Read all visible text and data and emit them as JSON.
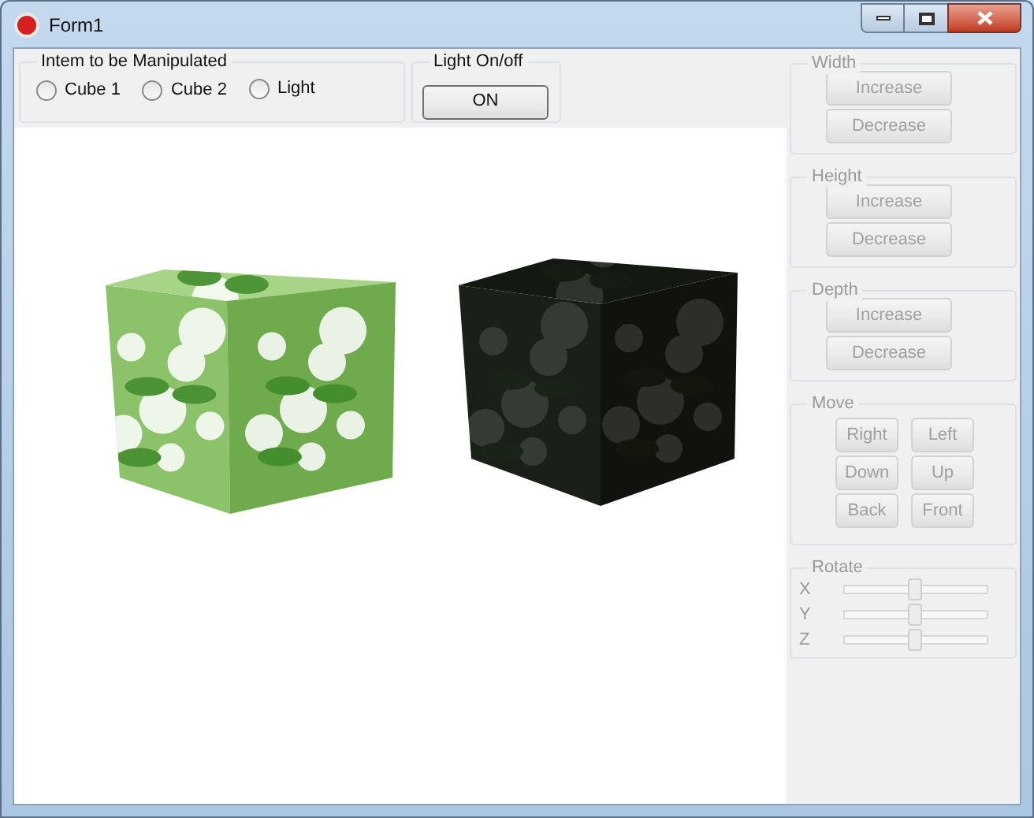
{
  "window": {
    "title": "Form1"
  },
  "item_group": {
    "label": "Intem to be Manipulated",
    "options": [
      {
        "label": "Cube 1",
        "selected": false
      },
      {
        "label": "Cube 2",
        "selected": false
      },
      {
        "label": "Light",
        "selected": false
      }
    ]
  },
  "light_group": {
    "label": "Light On/off",
    "button": "ON"
  },
  "size_groups": [
    {
      "label": "Width",
      "disabled": true,
      "buttons": [
        "Increase",
        "Decrease"
      ]
    },
    {
      "label": "Height",
      "disabled": true,
      "buttons": [
        "Increase",
        "Decrease"
      ]
    },
    {
      "label": "Depth",
      "disabled": true,
      "buttons": [
        "Increase",
        "Decrease"
      ]
    }
  ],
  "move_group": {
    "label": "Move",
    "disabled": true,
    "buttons": [
      "Right",
      "Left",
      "Down",
      "Up",
      "Back",
      "Front"
    ]
  },
  "rotate_group": {
    "label": "Rotate",
    "disabled": true,
    "sliders": [
      {
        "label": "X",
        "level": 0.5
      },
      {
        "label": "Y",
        "level": 0.5
      },
      {
        "label": "Z",
        "level": 0.5
      }
    ]
  }
}
